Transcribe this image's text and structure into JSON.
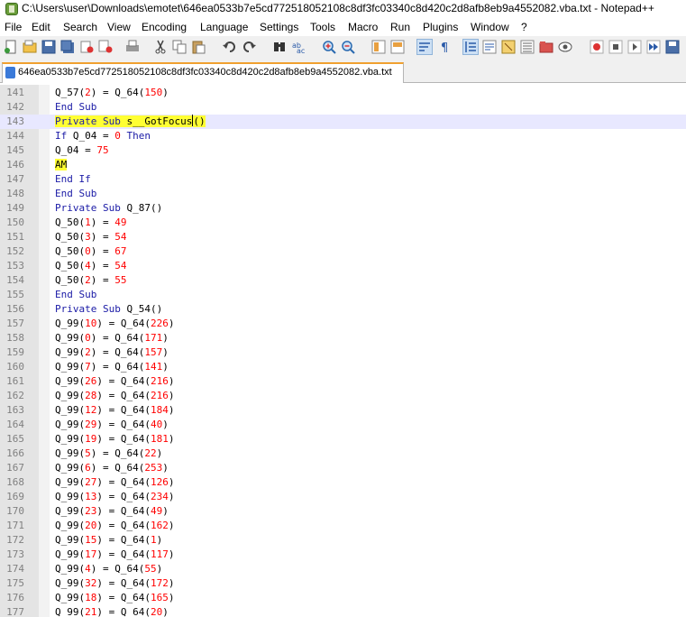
{
  "window": {
    "title": "C:\\Users\\user\\Downloads\\emotet\\646ea0533b7e5cd772518052108c8df3fc03340c8d420c2d8afb8eb9a4552082.vba.txt - Notepad++"
  },
  "menu": [
    "File",
    "Edit",
    "Search",
    "View",
    "Encoding",
    "Language",
    "Settings",
    "Tools",
    "Macro",
    "Run",
    "Plugins",
    "Window",
    "?"
  ],
  "toolbar": {
    "icons": [
      "new-file-icon",
      "open-file-icon",
      "save-icon",
      "save-all-icon",
      "close-icon",
      "close-all-icon",
      "print-icon",
      "cut-icon",
      "copy-icon",
      "paste-icon",
      "undo-icon",
      "redo-icon",
      "find-icon",
      "replace-icon",
      "zoom-in-icon",
      "zoom-out-icon",
      "sync-vertical-icon",
      "sync-horizontal-icon",
      "word-wrap-icon",
      "show-all-chars-icon",
      "indent-guide-icon",
      "udl-icon",
      "doc-map-icon",
      "function-list-icon",
      "folder-workspace-icon",
      "monitoring-icon",
      "record-macro-icon",
      "stop-record-icon",
      "play-macro-icon",
      "run-macro-multiple-icon",
      "save-macro-icon"
    ]
  },
  "tab": {
    "label": "646ea0533b7e5cd772518052108c8df3fc03340c8d420c2d8afb8eb9a4552082.vba.txt"
  },
  "editor": {
    "lines": [
      {
        "n": "141",
        "t": [
          [
            "",
            "Q_57("
          ],
          [
            "num",
            "2"
          ],
          [
            "",
            ") = Q_64("
          ],
          [
            "num",
            "150"
          ],
          [
            "",
            ")"
          ]
        ]
      },
      {
        "n": "142",
        "t": [
          [
            "kw",
            "End Sub"
          ]
        ]
      },
      {
        "n": "143",
        "current": true,
        "t": [
          [
            "kwhl",
            "Private Sub"
          ],
          [
            "hl",
            " s__GotFocus"
          ],
          [
            "caret",
            ""
          ],
          [
            "hl",
            "()"
          ]
        ]
      },
      {
        "n": "144",
        "t": [
          [
            "kw",
            "If"
          ],
          [
            "",
            " Q_04 = "
          ],
          [
            "num",
            "0"
          ],
          [
            "",
            " "
          ],
          [
            "kw",
            "Then"
          ]
        ]
      },
      {
        "n": "145",
        "t": [
          [
            "",
            "Q_04 = "
          ],
          [
            "num",
            "75"
          ]
        ]
      },
      {
        "n": "146",
        "t": [
          [
            "hl",
            "AM"
          ]
        ]
      },
      {
        "n": "147",
        "t": [
          [
            "kw",
            "End If"
          ]
        ]
      },
      {
        "n": "148",
        "t": [
          [
            "kw",
            "End Sub"
          ]
        ]
      },
      {
        "n": "149",
        "t": [
          [
            "kw",
            "Private Sub"
          ],
          [
            "",
            " Q_87()"
          ]
        ]
      },
      {
        "n": "150",
        "t": [
          [
            "",
            "Q_50("
          ],
          [
            "num",
            "1"
          ],
          [
            "",
            ") = "
          ],
          [
            "num",
            "49"
          ]
        ]
      },
      {
        "n": "151",
        "t": [
          [
            "",
            "Q_50("
          ],
          [
            "num",
            "3"
          ],
          [
            "",
            ") = "
          ],
          [
            "num",
            "54"
          ]
        ]
      },
      {
        "n": "152",
        "t": [
          [
            "",
            "Q_50("
          ],
          [
            "num",
            "0"
          ],
          [
            "",
            ") = "
          ],
          [
            "num",
            "67"
          ]
        ]
      },
      {
        "n": "153",
        "t": [
          [
            "",
            "Q_50("
          ],
          [
            "num",
            "4"
          ],
          [
            "",
            ") = "
          ],
          [
            "num",
            "54"
          ]
        ]
      },
      {
        "n": "154",
        "t": [
          [
            "",
            "Q_50("
          ],
          [
            "num",
            "2"
          ],
          [
            "",
            ") = "
          ],
          [
            "num",
            "55"
          ]
        ]
      },
      {
        "n": "155",
        "t": [
          [
            "kw",
            "End Sub"
          ]
        ]
      },
      {
        "n": "156",
        "t": [
          [
            "kw",
            "Private Sub"
          ],
          [
            "",
            " Q_54()"
          ]
        ]
      },
      {
        "n": "157",
        "t": [
          [
            "",
            "Q_99("
          ],
          [
            "num",
            "10"
          ],
          [
            "",
            ") = Q_64("
          ],
          [
            "num",
            "226"
          ],
          [
            "",
            ")"
          ]
        ]
      },
      {
        "n": "158",
        "t": [
          [
            "",
            "Q_99("
          ],
          [
            "num",
            "0"
          ],
          [
            "",
            ") = Q_64("
          ],
          [
            "num",
            "171"
          ],
          [
            "",
            ")"
          ]
        ]
      },
      {
        "n": "159",
        "t": [
          [
            "",
            "Q_99("
          ],
          [
            "num",
            "2"
          ],
          [
            "",
            ") = Q_64("
          ],
          [
            "num",
            "157"
          ],
          [
            "",
            ")"
          ]
        ]
      },
      {
        "n": "160",
        "t": [
          [
            "",
            "Q_99("
          ],
          [
            "num",
            "7"
          ],
          [
            "",
            ") = Q_64("
          ],
          [
            "num",
            "141"
          ],
          [
            "",
            ")"
          ]
        ]
      },
      {
        "n": "161",
        "t": [
          [
            "",
            "Q_99("
          ],
          [
            "num",
            "26"
          ],
          [
            "",
            ") = Q_64("
          ],
          [
            "num",
            "216"
          ],
          [
            "",
            ")"
          ]
        ]
      },
      {
        "n": "162",
        "t": [
          [
            "",
            "Q_99("
          ],
          [
            "num",
            "28"
          ],
          [
            "",
            ") = Q_64("
          ],
          [
            "num",
            "216"
          ],
          [
            "",
            ")"
          ]
        ]
      },
      {
        "n": "163",
        "t": [
          [
            "",
            "Q_99("
          ],
          [
            "num",
            "12"
          ],
          [
            "",
            ") = Q_64("
          ],
          [
            "num",
            "184"
          ],
          [
            "",
            ")"
          ]
        ]
      },
      {
        "n": "164",
        "t": [
          [
            "",
            "Q_99("
          ],
          [
            "num",
            "29"
          ],
          [
            "",
            ") = Q_64("
          ],
          [
            "num",
            "40"
          ],
          [
            "",
            ")"
          ]
        ]
      },
      {
        "n": "165",
        "t": [
          [
            "",
            "Q_99("
          ],
          [
            "num",
            "19"
          ],
          [
            "",
            ") = Q_64("
          ],
          [
            "num",
            "181"
          ],
          [
            "",
            ")"
          ]
        ]
      },
      {
        "n": "166",
        "t": [
          [
            "",
            "Q_99("
          ],
          [
            "num",
            "5"
          ],
          [
            "",
            ") = Q_64("
          ],
          [
            "num",
            "22"
          ],
          [
            "",
            ")"
          ]
        ]
      },
      {
        "n": "167",
        "t": [
          [
            "",
            "Q_99("
          ],
          [
            "num",
            "6"
          ],
          [
            "",
            ") = Q_64("
          ],
          [
            "num",
            "253"
          ],
          [
            "",
            ")"
          ]
        ]
      },
      {
        "n": "168",
        "t": [
          [
            "",
            "Q_99("
          ],
          [
            "num",
            "27"
          ],
          [
            "",
            ") = Q_64("
          ],
          [
            "num",
            "126"
          ],
          [
            "",
            ")"
          ]
        ]
      },
      {
        "n": "169",
        "t": [
          [
            "",
            "Q_99("
          ],
          [
            "num",
            "13"
          ],
          [
            "",
            ") = Q_64("
          ],
          [
            "num",
            "234"
          ],
          [
            "",
            ")"
          ]
        ]
      },
      {
        "n": "170",
        "t": [
          [
            "",
            "Q_99("
          ],
          [
            "num",
            "23"
          ],
          [
            "",
            ") = Q_64("
          ],
          [
            "num",
            "49"
          ],
          [
            "",
            ")"
          ]
        ]
      },
      {
        "n": "171",
        "t": [
          [
            "",
            "Q_99("
          ],
          [
            "num",
            "20"
          ],
          [
            "",
            ") = Q_64("
          ],
          [
            "num",
            "162"
          ],
          [
            "",
            ")"
          ]
        ]
      },
      {
        "n": "172",
        "t": [
          [
            "",
            "Q_99("
          ],
          [
            "num",
            "15"
          ],
          [
            "",
            ") = Q_64("
          ],
          [
            "num",
            "1"
          ],
          [
            "",
            ")"
          ]
        ]
      },
      {
        "n": "173",
        "t": [
          [
            "",
            "Q_99("
          ],
          [
            "num",
            "17"
          ],
          [
            "",
            ") = Q_64("
          ],
          [
            "num",
            "117"
          ],
          [
            "",
            ")"
          ]
        ]
      },
      {
        "n": "174",
        "t": [
          [
            "",
            "Q_99("
          ],
          [
            "num",
            "4"
          ],
          [
            "",
            ") = Q_64("
          ],
          [
            "num",
            "55"
          ],
          [
            "",
            ")"
          ]
        ]
      },
      {
        "n": "175",
        "t": [
          [
            "",
            "Q_99("
          ],
          [
            "num",
            "32"
          ],
          [
            "",
            ") = Q_64("
          ],
          [
            "num",
            "172"
          ],
          [
            "",
            ")"
          ]
        ]
      },
      {
        "n": "176",
        "t": [
          [
            "",
            "Q_99("
          ],
          [
            "num",
            "18"
          ],
          [
            "",
            ") = Q_64("
          ],
          [
            "num",
            "165"
          ],
          [
            "",
            ")"
          ]
        ]
      },
      {
        "n": "177",
        "t": [
          [
            "",
            "Q_99("
          ],
          [
            "num",
            "21"
          ],
          [
            "",
            ") = Q_64("
          ],
          [
            "num",
            "20"
          ],
          [
            "",
            ")"
          ]
        ]
      }
    ]
  }
}
